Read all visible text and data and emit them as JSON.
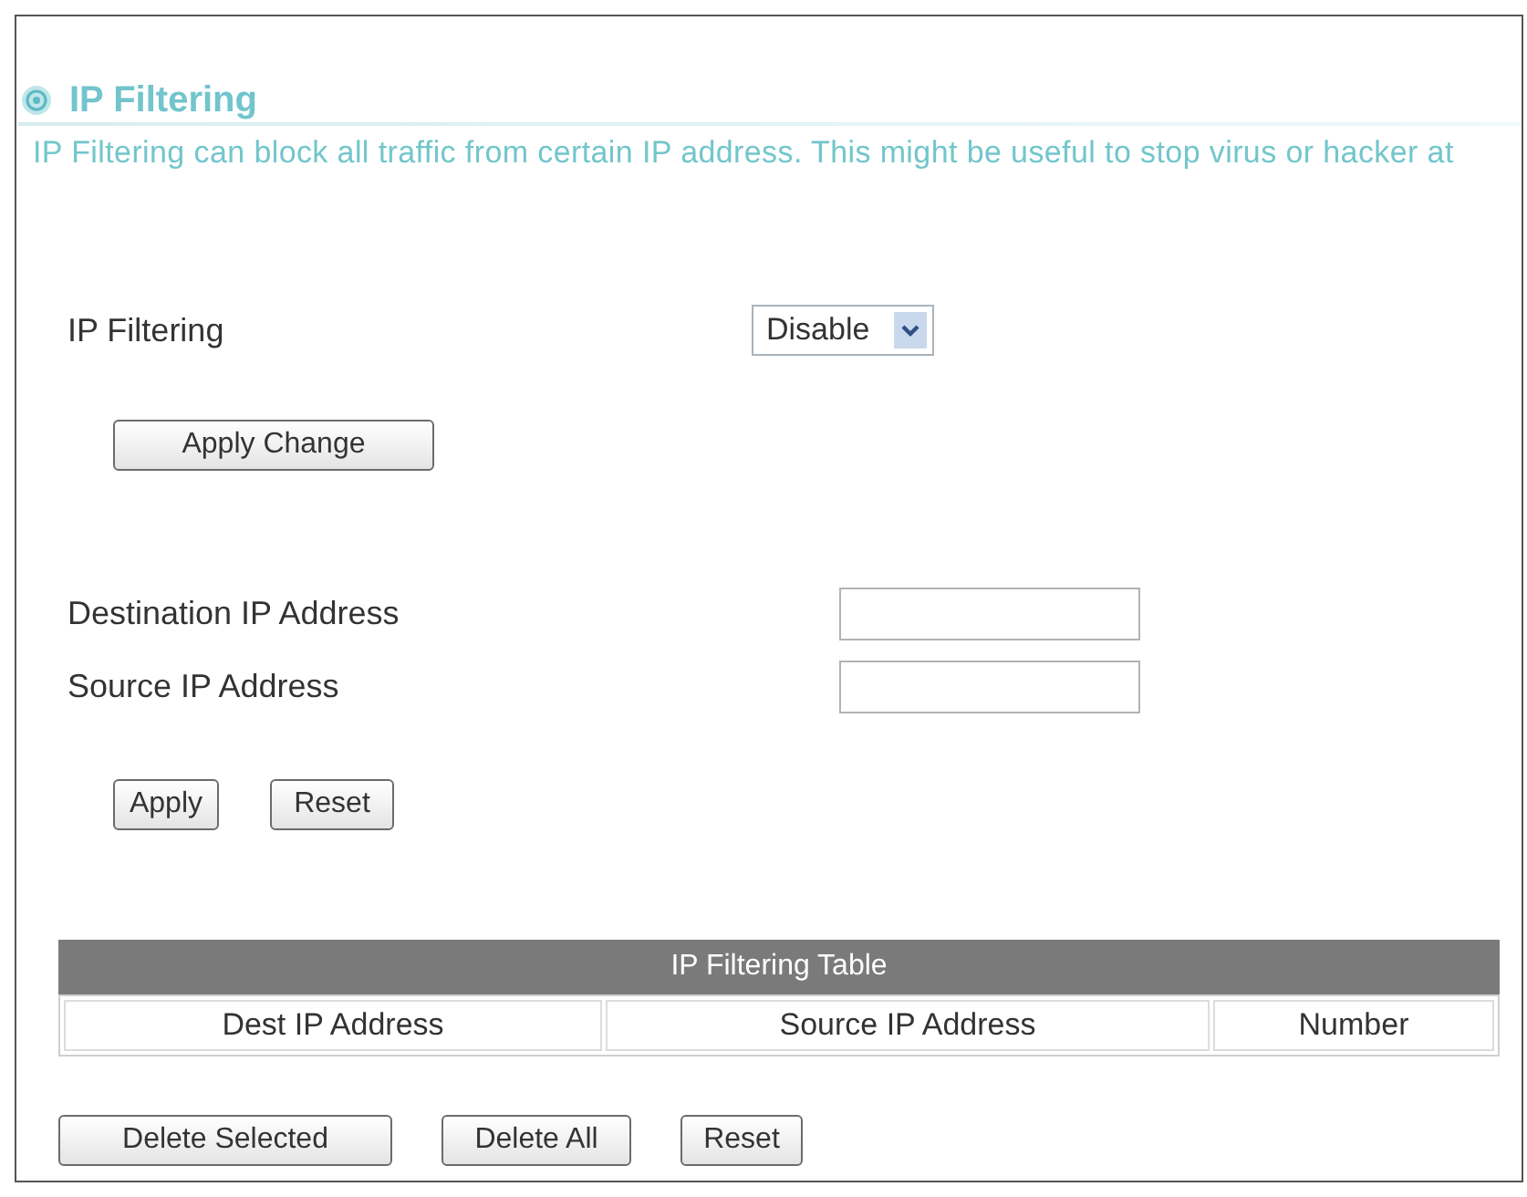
{
  "section": {
    "title": "IP Filtering",
    "description": "IP Filtering can block all traffic from certain IP address. This might be useful to stop virus or hacker at"
  },
  "filter_setting": {
    "label": "IP Filtering",
    "select_value": "Disable",
    "apply_button": "Apply Change"
  },
  "address_form": {
    "fields": [
      {
        "label": "Destination IP Address"
      },
      {
        "label": "Source IP Address"
      }
    ],
    "buttons": [
      "Apply",
      "Reset"
    ]
  },
  "filter_table": {
    "title": "IP Filtering Table",
    "columns": [
      "Dest IP Address",
      "Source IP Address",
      "Number"
    ]
  },
  "table_buttons": [
    "Delete Selected",
    "Delete All",
    "Reset"
  ]
}
